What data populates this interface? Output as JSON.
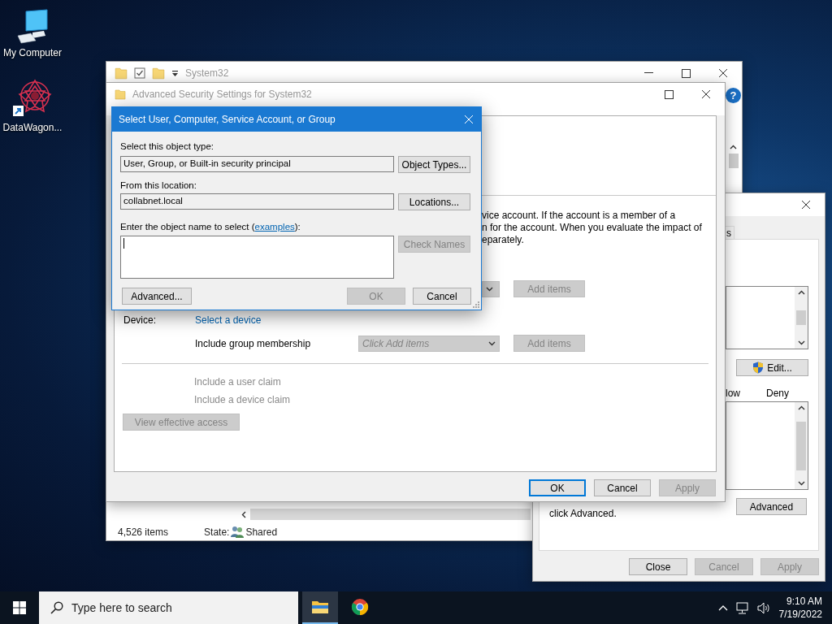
{
  "desktop": {
    "icons": [
      {
        "kind": "computer",
        "label": "My Computer"
      },
      {
        "kind": "shortcut",
        "label": "DataWagon..."
      }
    ]
  },
  "explorer": {
    "title": "System32",
    "help_glyph": "?",
    "status": {
      "count": "4,526 items",
      "state_label": "State:",
      "state_value": "Shared"
    }
  },
  "properties": {
    "tab": "s",
    "edit_button": "Edit...",
    "columns": [
      "low",
      "Deny"
    ],
    "note": "click Advanced.",
    "advanced_button": "Advanced",
    "buttons": [
      {
        "label": "Close",
        "disabled": false
      },
      {
        "label": "Cancel",
        "disabled": true
      },
      {
        "label": "Apply",
        "disabled": true
      }
    ]
  },
  "advanced_security": {
    "title": "Advanced Security Settings for System32",
    "description_lines": [
      "vice account. If the account is a member of a",
      "n for the account. When you evaluate the impact of",
      "eparately."
    ],
    "user_row": {
      "add_button": {
        "label": "Add items",
        "disabled": true
      }
    },
    "device": {
      "label": "Device:",
      "link": "Select a device"
    },
    "group_membership": {
      "label": "Include group membership",
      "dropdown": {
        "placeholder": "Click Add items",
        "disabled": true
      },
      "add_button": {
        "label": "Add items",
        "disabled": true
      }
    },
    "claims": [
      {
        "label": "Include a user claim",
        "disabled": true
      },
      {
        "label": "Include a device claim",
        "disabled": true
      }
    ],
    "view_button": {
      "label": "View effective access",
      "disabled": true
    },
    "buttons": [
      {
        "label": "OK",
        "disabled": false,
        "focused": true
      },
      {
        "label": "Cancel",
        "disabled": false,
        "focused": false
      },
      {
        "label": "Apply",
        "disabled": true,
        "focused": false
      }
    ]
  },
  "select_dialog": {
    "title": "Select User, Computer, Service Account, or Group",
    "object_type": {
      "label": "Select this object type:",
      "value": "User, Group, or Built-in security principal",
      "button": "Object Types..."
    },
    "location": {
      "label": "From this location:",
      "value": "collabnet.local",
      "button": "Locations..."
    },
    "name_entry": {
      "label_before": "Enter the object name to select (",
      "link": "examples",
      "label_after": "):"
    },
    "check_names": {
      "label": "Check Names",
      "disabled": true
    },
    "advanced_button": "Advanced...",
    "buttons": [
      {
        "label": "OK",
        "disabled": true
      },
      {
        "label": "Cancel",
        "disabled": false
      }
    ]
  },
  "taskbar": {
    "search_placeholder": "Type here to search",
    "apps": [
      {
        "kind": "explorer",
        "active": true
      },
      {
        "kind": "chrome",
        "active": false
      }
    ],
    "time": "9:10 AM",
    "date": "7/19/2022"
  }
}
